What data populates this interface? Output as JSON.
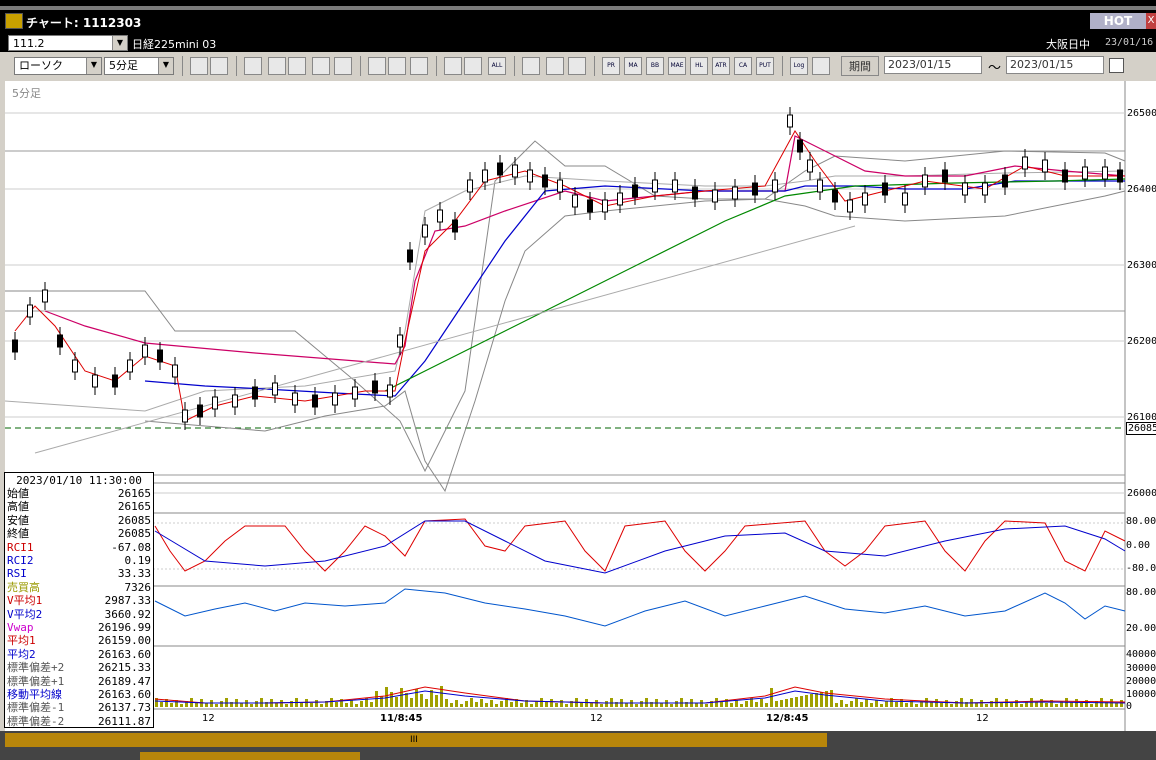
{
  "window": {
    "title": "チャート: 1112303",
    "hot_label": "HOT",
    "close_label": "X"
  },
  "header": {
    "code": "111.2",
    "name": "日経225mini 03",
    "market": "大阪日中",
    "date": "23/01/16"
  },
  "toolbar": {
    "chart_type": "ローソク",
    "interval": "5分足",
    "period_label": "期間",
    "date_from": "2023/01/15",
    "date_to": "2023/01/15",
    "tilde": "〜",
    "icons": [
      {
        "name": "zoom-icon",
        "label": ""
      },
      {
        "name": "grid-icon",
        "label": ""
      },
      {
        "name": "crosshair-icon",
        "label": ""
      },
      {
        "name": "zoom-chart-icon",
        "label": ""
      },
      {
        "name": "candle-icon",
        "label": ""
      },
      {
        "name": "trend-icon",
        "label": ""
      },
      {
        "name": "calculator-icon",
        "label": ""
      },
      {
        "name": "pencil-icon",
        "label": ""
      },
      {
        "name": "cursor-icon",
        "label": ""
      },
      {
        "name": "undo-icon",
        "label": ""
      },
      {
        "name": "line-a-icon",
        "label": ""
      },
      {
        "name": "line-b-icon",
        "label": ""
      },
      {
        "name": "all-icon",
        "label": "ALL"
      },
      {
        "name": "settings-icon",
        "label": ""
      },
      {
        "name": "wrench-icon",
        "label": ""
      },
      {
        "name": "palette-icon",
        "label": ""
      },
      {
        "name": "pr-icon",
        "label": "PR"
      },
      {
        "name": "ma-icon",
        "label": "MA"
      },
      {
        "name": "bb-icon",
        "label": "BB"
      },
      {
        "name": "mae-icon",
        "label": "MAE"
      },
      {
        "name": "hl-icon",
        "label": "HL"
      },
      {
        "name": "atr-icon",
        "label": "ATR"
      },
      {
        "name": "ca-icon",
        "label": "CA"
      },
      {
        "name": "put-icon",
        "label": "PUT"
      },
      {
        "name": "log-icon",
        "label": "Log"
      },
      {
        "name": "export-icon",
        "label": ""
      }
    ]
  },
  "chart": {
    "interval_label": "5分足",
    "price_axis": [
      "26500",
      "26400",
      "26300",
      "26200",
      "26100",
      "26000"
    ],
    "current_price": "26085",
    "osc_axis": [
      "80.00",
      "0.00",
      "-80.0"
    ],
    "osc2_axis": [
      "80.00",
      "20.00"
    ],
    "vol_axis": [
      "40000",
      "30000",
      "20000",
      "10000",
      "0"
    ],
    "time_labels": [
      "12",
      "11/8:45",
      "12",
      "12/8:45",
      "12"
    ]
  },
  "data_panel": {
    "datetime": "2023/01/10  11:30:00",
    "rows": [
      {
        "label": "始値",
        "value": "26165",
        "color": "#000000"
      },
      {
        "label": "高値",
        "value": "26165",
        "color": "#000000"
      },
      {
        "label": "安値",
        "value": "26085",
        "color": "#000000"
      },
      {
        "label": "終値",
        "value": "26085",
        "color": "#000000"
      },
      {
        "label": "RCI1",
        "value": "-67.08",
        "color": "#cc0000"
      },
      {
        "label": "RCI2",
        "value": "0.19",
        "color": "#0000cc"
      },
      {
        "label": "RSI",
        "value": "33.33",
        "color": "#0000cc"
      },
      {
        "label": "売買高",
        "value": "7326",
        "color": "#999900"
      },
      {
        "label": "V平均1",
        "value": "2987.33",
        "color": "#cc0000"
      },
      {
        "label": "V平均2",
        "value": "3660.92",
        "color": "#0000cc"
      },
      {
        "label": "Vwap",
        "value": "26196.99",
        "color": "#cc00cc"
      },
      {
        "label": "平均1",
        "value": "26159.00",
        "color": "#cc0000"
      },
      {
        "label": "平均2",
        "value": "26163.60",
        "color": "#0000cc"
      },
      {
        "label": "標準偏差+2",
        "value": "26215.33",
        "color": "#555555"
      },
      {
        "label": "標準偏差+1",
        "value": "26189.47",
        "color": "#555555"
      },
      {
        "label": "移動平均線",
        "value": "26163.60",
        "color": "#0000cc"
      },
      {
        "label": "標準偏差-1",
        "value": "26137.73",
        "color": "#555555"
      },
      {
        "label": "標準偏差-2",
        "value": "26111.87",
        "color": "#555555"
      }
    ]
  },
  "scroll": {
    "grip": "III"
  }
}
